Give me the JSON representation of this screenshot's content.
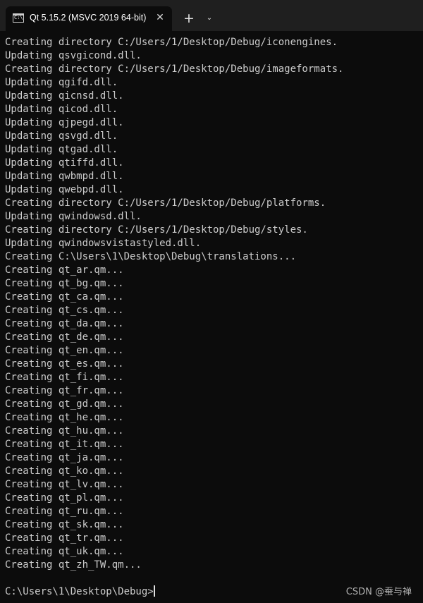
{
  "tab": {
    "icon": "console-icon",
    "icon_text": "C:\\",
    "title": "Qt 5.15.2 (MSVC 2019 64-bit)",
    "close_symbol": "✕"
  },
  "titlebar": {
    "new_tab_symbol": "+",
    "dropdown_symbol": "⌄"
  },
  "console": {
    "lines": [
      "Creating directory C:/Users/1/Desktop/Debug/iconengines.",
      "Updating qsvgicond.dll.",
      "Creating directory C:/Users/1/Desktop/Debug/imageformats.",
      "Updating qgifd.dll.",
      "Updating qicnsd.dll.",
      "Updating qicod.dll.",
      "Updating qjpegd.dll.",
      "Updating qsvgd.dll.",
      "Updating qtgad.dll.",
      "Updating qtiffd.dll.",
      "Updating qwbmpd.dll.",
      "Updating qwebpd.dll.",
      "Creating directory C:/Users/1/Desktop/Debug/platforms.",
      "Updating qwindowsd.dll.",
      "Creating directory C:/Users/1/Desktop/Debug/styles.",
      "Updating qwindowsvistastyled.dll.",
      "Creating C:\\Users\\1\\Desktop\\Debug\\translations...",
      "Creating qt_ar.qm...",
      "Creating qt_bg.qm...",
      "Creating qt_ca.qm...",
      "Creating qt_cs.qm...",
      "Creating qt_da.qm...",
      "Creating qt_de.qm...",
      "Creating qt_en.qm...",
      "Creating qt_es.qm...",
      "Creating qt_fi.qm...",
      "Creating qt_fr.qm...",
      "Creating qt_gd.qm...",
      "Creating qt_he.qm...",
      "Creating qt_hu.qm...",
      "Creating qt_it.qm...",
      "Creating qt_ja.qm...",
      "Creating qt_ko.qm...",
      "Creating qt_lv.qm...",
      "Creating qt_pl.qm...",
      "Creating qt_ru.qm...",
      "Creating qt_sk.qm...",
      "Creating qt_tr.qm...",
      "Creating qt_uk.qm...",
      "Creating qt_zh_TW.qm..."
    ],
    "prompt": "C:\\Users\\1\\Desktop\\Debug>"
  },
  "watermark": "CSDN @蚕与禅"
}
